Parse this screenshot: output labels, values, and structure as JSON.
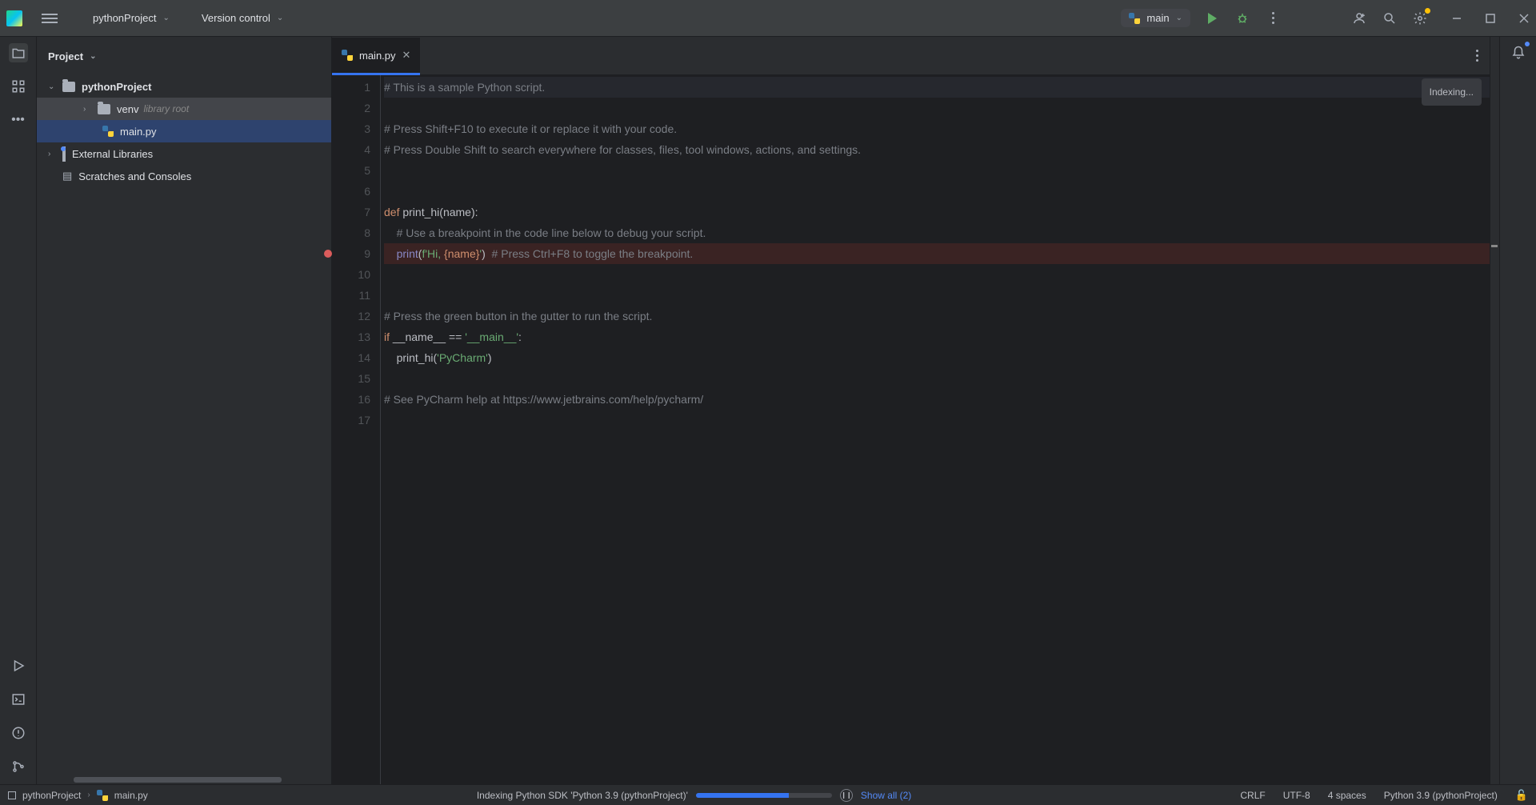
{
  "titlebar": {
    "project_name": "pythonProject",
    "vcs_label": "Version control",
    "run_config": "main"
  },
  "project_panel": {
    "header": "Project",
    "root": "pythonProject",
    "venv": "venv",
    "venv_note": "library root",
    "main_file": "main.py",
    "ext_lib": "External Libraries",
    "scratches": "Scratches and Consoles"
  },
  "tab": {
    "name": "main.py"
  },
  "editor": {
    "indexing_label": "Indexing...",
    "lines": [
      {
        "n": 1,
        "t": "comment",
        "text": "# This is a sample Python script."
      },
      {
        "n": 2,
        "t": "blank",
        "text": ""
      },
      {
        "n": 3,
        "t": "comment",
        "text": "# Press Shift+F10 to execute it or replace it with your code."
      },
      {
        "n": 4,
        "t": "comment",
        "text": "# Press Double Shift to search everywhere for classes, files, tool windows, actions, and settings."
      },
      {
        "n": 5,
        "t": "blank",
        "text": ""
      },
      {
        "n": 6,
        "t": "blank",
        "text": ""
      },
      {
        "n": 7,
        "t": "def",
        "kw": "def ",
        "fn": "print_hi",
        "tail": "(name):"
      },
      {
        "n": 8,
        "t": "comment",
        "indent": "    ",
        "text": "# Use a breakpoint in the code line below to debug your script."
      },
      {
        "n": 9,
        "t": "print",
        "bp": true,
        "indent": "    ",
        "builtin": "print",
        "open": "(",
        "f": "f",
        "s1": "'Hi, ",
        "place": "{name}",
        "s2": "'",
        "close": ")",
        "trail": "  # Press Ctrl+F8 to toggle the breakpoint."
      },
      {
        "n": 10,
        "t": "blank",
        "text": ""
      },
      {
        "n": 11,
        "t": "blank",
        "text": ""
      },
      {
        "n": 12,
        "t": "comment",
        "text": "# Press the green button in the gutter to run the script."
      },
      {
        "n": 13,
        "t": "if",
        "kw": "if ",
        "a": "__name__ == ",
        "s": "'__main__'",
        "tail": ":"
      },
      {
        "n": 14,
        "t": "call",
        "indent": "    ",
        "fn": "print_hi(",
        "s": "'PyCharm'",
        "tail": ")"
      },
      {
        "n": 15,
        "t": "blank",
        "text": ""
      },
      {
        "n": 16,
        "t": "comment",
        "text": "# See PyCharm help at https://www.jetbrains.com/help/pycharm/"
      },
      {
        "n": 17,
        "t": "blank",
        "text": ""
      }
    ]
  },
  "status": {
    "crumb_root": "pythonProject",
    "crumb_file": "main.py",
    "indexing_text": "Indexing Python SDK 'Python 3.9 (pythonProject)'",
    "show_all": "Show all (2)",
    "eol": "CRLF",
    "encoding": "UTF-8",
    "indent": "4 spaces",
    "interpreter": "Python 3.9 (pythonProject)"
  }
}
